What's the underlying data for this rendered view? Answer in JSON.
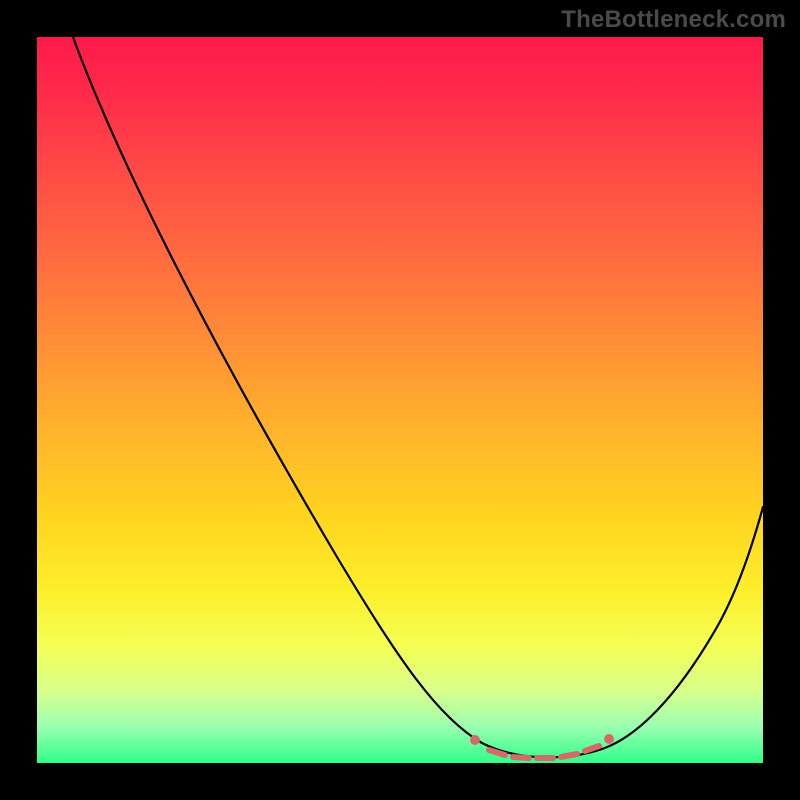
{
  "watermark": "TheBottleneck.com",
  "colors": {
    "accent_marker": "#d46a6a",
    "curve": "#000000",
    "frame": "#000000"
  },
  "chart_data": {
    "type": "line",
    "title": "",
    "xlabel": "",
    "ylabel": "",
    "xlim": [
      0,
      100
    ],
    "ylim": [
      0,
      100
    ],
    "grid": false,
    "legend": false,
    "series": [
      {
        "name": "bottleneck-curve",
        "x": [
          0,
          8,
          16,
          24,
          32,
          40,
          48,
          56,
          62,
          66,
          70,
          74,
          78,
          82,
          88,
          94,
          100
        ],
        "y": [
          100,
          90,
          80,
          70,
          60,
          49,
          38,
          26,
          15,
          7,
          2,
          0.5,
          0.5,
          2,
          12,
          28,
          48
        ]
      }
    ],
    "markers": {
      "name": "highlight-segment",
      "x": [
        62,
        65,
        68,
        71,
        74,
        77,
        80,
        82
      ],
      "y": [
        3.5,
        1.5,
        0.8,
        0.5,
        0.5,
        0.8,
        1.5,
        3.5
      ]
    }
  }
}
